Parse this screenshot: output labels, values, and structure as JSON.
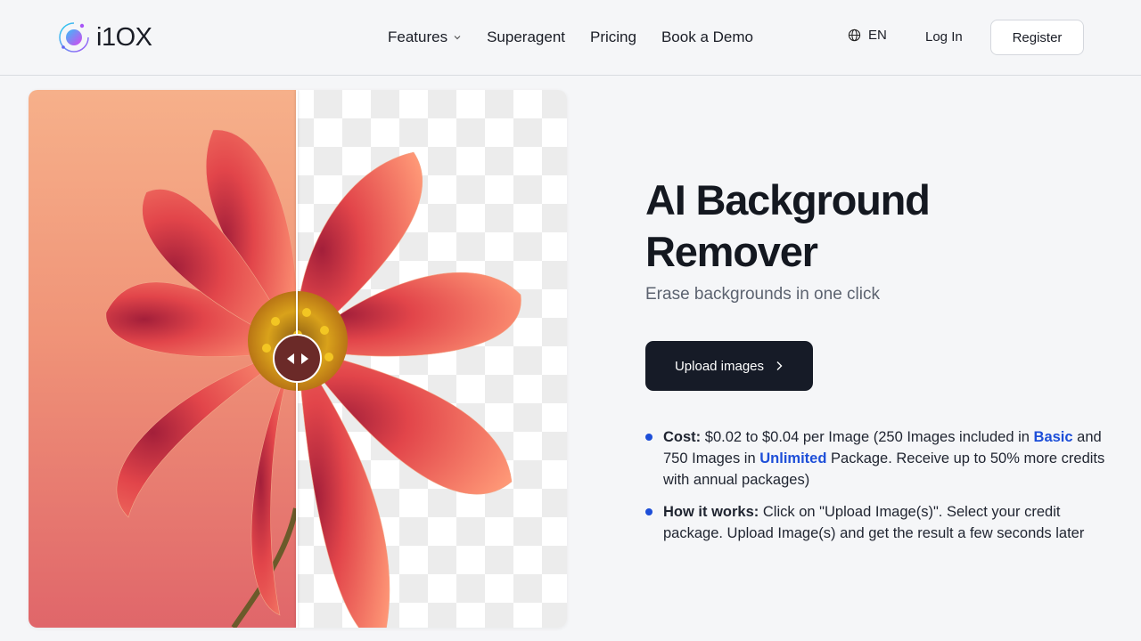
{
  "header": {
    "logo_text": "i1OX",
    "nav": [
      {
        "label": "Features",
        "has_dropdown": true
      },
      {
        "label": "Superagent"
      },
      {
        "label": "Pricing"
      },
      {
        "label": "Book a Demo"
      }
    ],
    "language": "EN",
    "login_label": "Log In",
    "register_label": "Register"
  },
  "hero": {
    "title": "AI Background Remover",
    "subtitle": "Erase backgrounds in one click",
    "upload_label": "Upload images",
    "bullets": {
      "cost": {
        "label": "Cost:",
        "text_1": "$0.02 to $0.04 per Image (250 Images included in",
        "link_basic": "Basic",
        "text_2": "and 750 Images in",
        "link_unlimited": "Unlimited",
        "text_3": "Package. Receive up to 50% more credits with annual packages)"
      },
      "how": {
        "label": "How it works:",
        "text": "Click on \"Upload Image(s)\". Select your credit package. Upload Image(s) and get the result a few seconds later"
      }
    }
  },
  "colors": {
    "primary_button": "#161b27",
    "link": "#1d4ed8",
    "bullet": "#1d4ed8",
    "background": "#f5f6f8"
  },
  "icons": {
    "logo": "logo-mark-icon",
    "features_dropdown": "chevron-down-icon",
    "language": "globe-icon",
    "upload_arrow": "chevron-right-icon",
    "compare_handle": "arrows-left-right-icon"
  }
}
